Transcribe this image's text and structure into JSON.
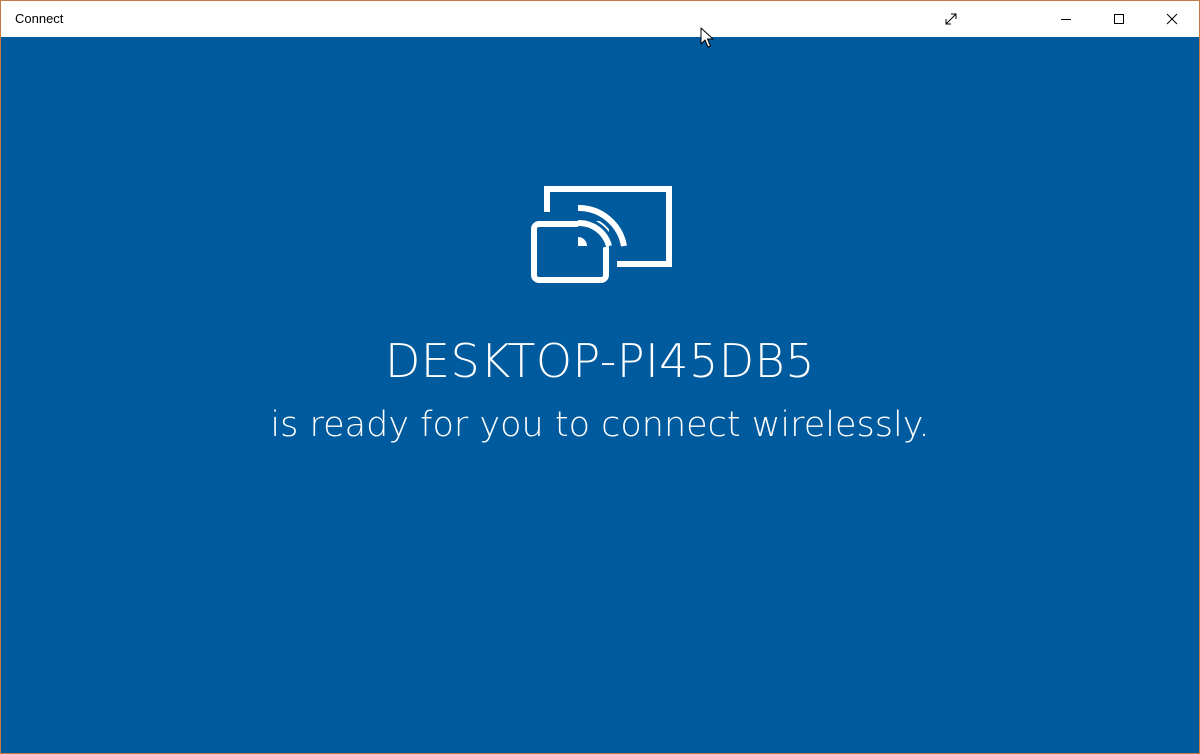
{
  "window": {
    "title": "Connect",
    "controls": {
      "fullscreen_icon": "expand-arrows-icon",
      "minimize_icon": "minimize-icon",
      "maximize_icon": "maximize-icon",
      "close_icon": "close-icon"
    }
  },
  "main": {
    "icon": "wireless-display-cast-icon",
    "device_name": "DESKTOP-PI45DB5",
    "status_text": "is ready for you to connect wirelessly."
  },
  "colors": {
    "background": "#005a9e",
    "titlebar": "#ffffff",
    "window_border": "#c77a45",
    "text": "#ffffff"
  }
}
